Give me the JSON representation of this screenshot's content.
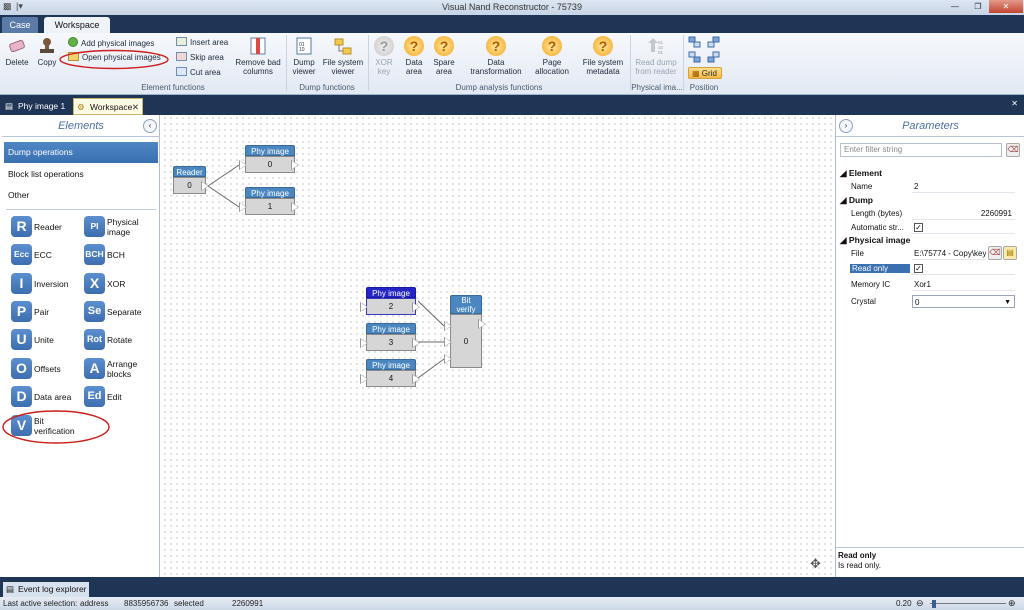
{
  "window": {
    "title": "Visual Nand Reconstructor - 75739",
    "qat": "|▾",
    "minimize": "—",
    "maximize": "❐",
    "close": "✕"
  },
  "ribbon_tabs": [
    "Case",
    "Workspace"
  ],
  "ribbon": {
    "delete": "Delete",
    "copy": "Copy",
    "add_physical_images": "Add physical images",
    "open_physical_images": "Open physical images",
    "insert_area": "Insert area",
    "skip_area": "Skip area",
    "cut_area": "Cut area",
    "remove_bad_columns": [
      "Remove bad",
      "columns"
    ],
    "dump_viewer": [
      "Dump",
      "viewer"
    ],
    "file_system_viewer": [
      "File system",
      "viewer"
    ],
    "xor_key": [
      "XOR",
      "key"
    ],
    "data_area": [
      "Data",
      "area"
    ],
    "spare_area": [
      "Spare",
      "area"
    ],
    "data_transformation": [
      "Data",
      "transformation"
    ],
    "page_allocation": [
      "Page",
      "allocation"
    ],
    "file_system_metadata": [
      "File system",
      "metadata"
    ],
    "read_dump_from_reader": [
      "Read dump",
      "from reader"
    ],
    "grid": "Grid",
    "groups": {
      "element_functions": "Element functions",
      "dump_functions": "Dump functions",
      "dump_analysis_functions": "Dump analysis functions",
      "physical_image": "Physical ima...",
      "position": "Position"
    }
  },
  "doc_tabs": [
    "Phy image 1",
    "Workspace"
  ],
  "elements_panel": {
    "title": "Elements",
    "categories": [
      "Dump operations",
      "Block list operations",
      "Other"
    ],
    "items": [
      {
        "icon": "R",
        "label": "Reader"
      },
      {
        "icon": "PI",
        "label": "Physical image"
      },
      {
        "icon": "Ecc",
        "label": "ECC"
      },
      {
        "icon": "BCH",
        "label": "BCH"
      },
      {
        "icon": "I",
        "label": "Inversion"
      },
      {
        "icon": "X",
        "label": "XOR"
      },
      {
        "icon": "P",
        "label": "Pair"
      },
      {
        "icon": "Se",
        "label": "Separate"
      },
      {
        "icon": "U",
        "label": "Unite"
      },
      {
        "icon": "Rot",
        "label": "Rotate"
      },
      {
        "icon": "O",
        "label": "Offsets"
      },
      {
        "icon": "A",
        "label": "Arrange blocks"
      },
      {
        "icon": "D",
        "label": "Data area"
      },
      {
        "icon": "Ed",
        "label": "Edit"
      },
      {
        "icon": "V",
        "label": "Bit verification"
      }
    ]
  },
  "canvas": {
    "reader": {
      "title": "Reader",
      "value": "0"
    },
    "phy_top_1": {
      "title": "Phy image",
      "value": "0"
    },
    "phy_top_2": {
      "title": "Phy image",
      "value": "1"
    },
    "phy_a": {
      "title": "Phy image",
      "value": "2"
    },
    "phy_b": {
      "title": "Phy image",
      "value": "3"
    },
    "phy_c": {
      "title": "Phy image",
      "value": "4"
    },
    "bit_verify": {
      "title": "Bit verify",
      "value": "0"
    }
  },
  "parameters": {
    "title": "Parameters",
    "filter_placeholder": "Enter filter string",
    "element_section": "Element",
    "name_label": "Name",
    "name_value": "2",
    "dump_section": "Dump",
    "length_label": "Length (bytes)",
    "length_value": "2260991",
    "auto_label": "Automatic str...",
    "auto_checked": "✓",
    "physical_section": "Physical image",
    "file_label": "File",
    "file_value": "E:\\75774 - Copy\\key",
    "readonly_label": "Read only",
    "readonly_checked": "✓",
    "memory_label": "Memory IC",
    "memory_value": "Xor1",
    "crystal_label": "Crystal",
    "crystal_value": "0",
    "desc_title": "Read only",
    "desc_text": "Is read only."
  },
  "bottom": {
    "event_log_tab": "Event log explorer"
  },
  "status": {
    "last_active": "Last active selection:",
    "address": "address",
    "address_value": "8835956736",
    "selected": "selected",
    "selected_value": "2260991",
    "zoom": "0.20"
  }
}
